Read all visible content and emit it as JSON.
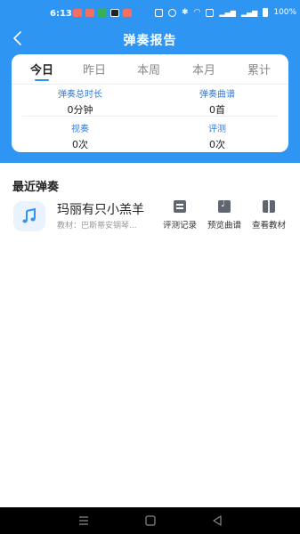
{
  "status_bar": {
    "time": "6:13",
    "battery_text": "100%",
    "app_icons": [
      "app-red-icon",
      "app-red-icon",
      "app-green-icon",
      "app-dark-icon",
      "app-red-icon"
    ],
    "system_icons": [
      "nfc-icon",
      "eye-icon",
      "bluetooth-icon",
      "wifi-icon",
      "sim-card-icon",
      "signal-icon",
      "signal-icon",
      "battery-icon"
    ]
  },
  "nav": {
    "title": "弹奏报告",
    "back_icon": "chevron-left-icon"
  },
  "tabs": [
    {
      "label": "今日",
      "active": true
    },
    {
      "label": "昨日",
      "active": false
    },
    {
      "label": "本周",
      "active": false
    },
    {
      "label": "本月",
      "active": false
    },
    {
      "label": "累计",
      "active": false
    }
  ],
  "stats": {
    "total_time": {
      "label": "弹奏总时长",
      "value": "0分钟"
    },
    "scores": {
      "label": "弹奏曲谱",
      "value": "0首"
    },
    "sight_reading": {
      "label": "视奏",
      "value": "0次"
    },
    "assessment": {
      "label": "评测",
      "value": "0次"
    }
  },
  "recent": {
    "title": "最近弹奏",
    "song": {
      "title": "玛丽有只小羔羊",
      "textbook": "教材：巴斯蒂安钢琴...",
      "cover_icon": "music-note-icon"
    },
    "actions": [
      {
        "label": "评测记录",
        "icon": "list-icon"
      },
      {
        "label": "预览曲谱",
        "icon": "music-note-icon"
      },
      {
        "label": "查看教材",
        "icon": "book-icon"
      }
    ]
  },
  "colors": {
    "primary": "#2f95f2",
    "stat_label": "#3a7bd5",
    "icon_gray": "#5f6670"
  },
  "bottom_nav": [
    "menu-icon",
    "home-icon",
    "back-triangle-icon"
  ]
}
